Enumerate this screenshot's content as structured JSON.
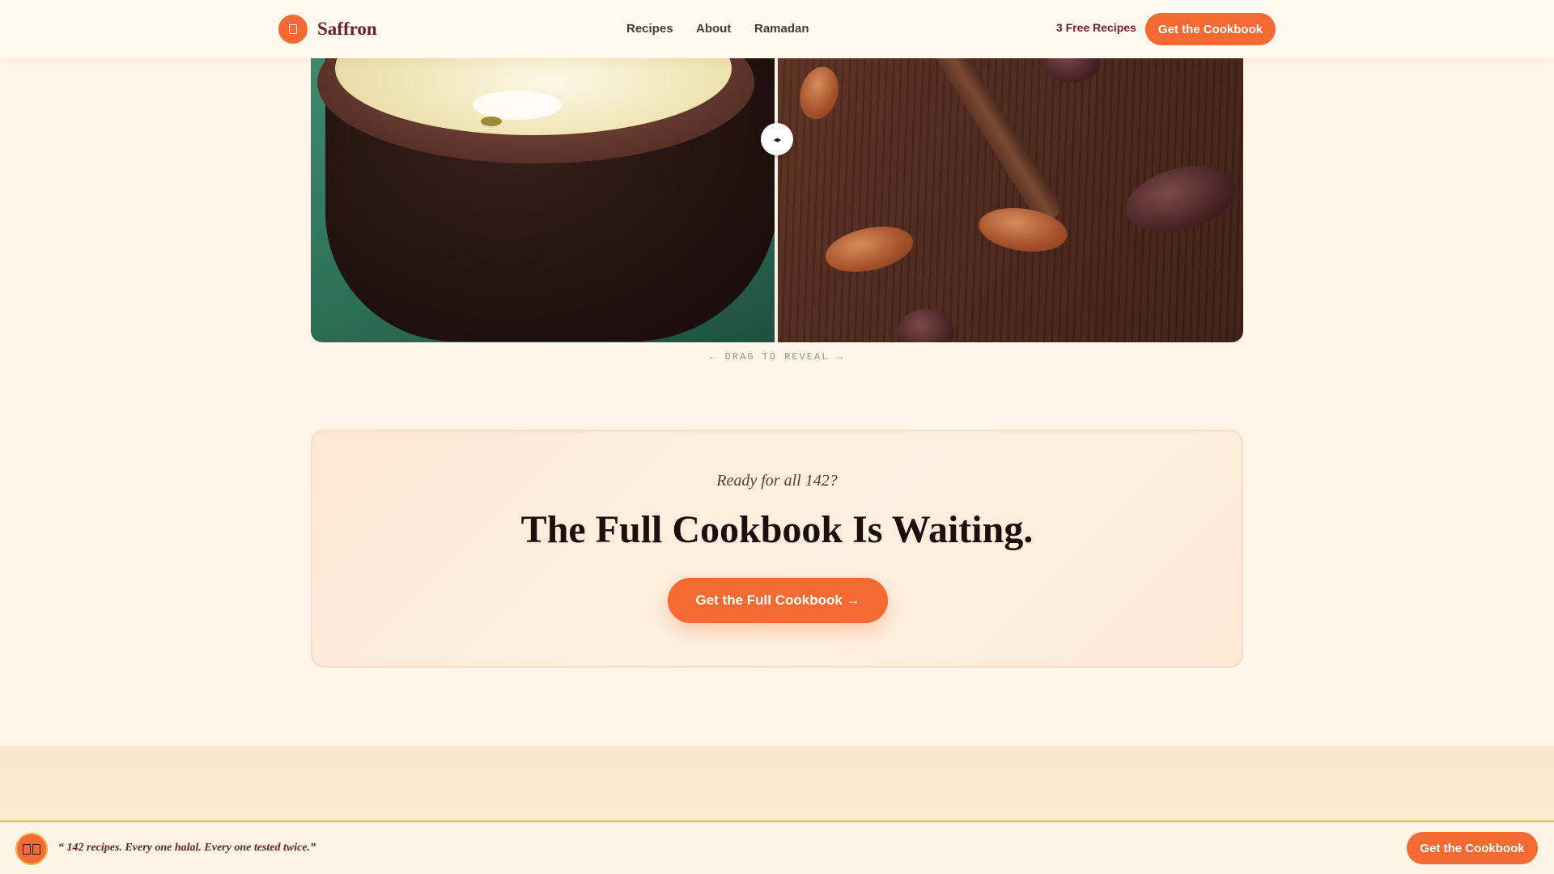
{
  "brand": {
    "name": "Saffron",
    "icon": "cookbook-icon"
  },
  "nav": {
    "items": [
      "Recipes",
      "About",
      "Ramadan"
    ]
  },
  "header": {
    "free_recipes": "3 Free Recipes",
    "cta_label": "Get the Cookbook"
  },
  "compare": {
    "hint": "← DRAG TO REVEAL →",
    "handle_icon": "drag-arrows-icon",
    "handle_glyph": "◂▸"
  },
  "cta": {
    "kicker": "Ready for all 142?",
    "title": "The Full Cookbook Is Waiting.",
    "button_label": "Get the Full Cookbook →"
  },
  "sticky": {
    "icon": "open-book-icon",
    "quote": "“ 142 recipes. Every one halal. Every one tested twice.”",
    "cta_label": "Get the Cookbook"
  },
  "colors": {
    "accent": "#f46a32",
    "brand_text": "#6b1f2a",
    "page_bg": "#fff5e8",
    "highlight_border": "#f2b250"
  }
}
